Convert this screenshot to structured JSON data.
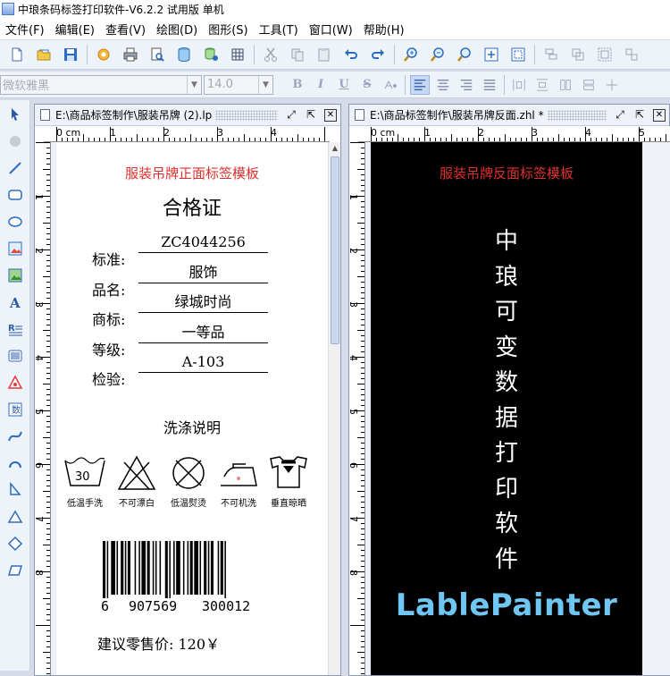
{
  "window": {
    "title": "中琅条码标签打印软件-V6.2.2 试用版 单机"
  },
  "menu": [
    "文件(F)",
    "编辑(E)",
    "查看(V)",
    "绘图(D)",
    "图形(S)",
    "工具(T)",
    "窗口(W)",
    "帮助(H)"
  ],
  "toolbar": {
    "icons": [
      "new-icon",
      "open-icon",
      "save-icon",
      "settings-icon",
      "print-icon",
      "print-preview-icon",
      "database-icon",
      "database-link-icon",
      "grid-icon",
      "cut-icon",
      "copy-icon",
      "paste-icon",
      "undo-icon",
      "redo-icon",
      "zoom-in-icon",
      "zoom-out-icon",
      "zoom-fit-icon",
      "zoom-page-icon",
      "select-all-icon"
    ],
    "font_name": "微软雅黑",
    "font_size": "14.0",
    "bold": "B",
    "italic": "I",
    "underline": "U",
    "strike": "S"
  },
  "left_tools": [
    "pointer-icon",
    "pan-icon",
    "line-icon",
    "rounded-rect-icon",
    "ellipse-icon",
    "image-icon",
    "picture-icon",
    "text-icon",
    "rich-text-icon",
    "barcode-icon",
    "qrcode-icon",
    "serial-icon",
    "curve-icon",
    "arc-icon",
    "polyline-icon",
    "triangle-icon",
    "diamond-icon",
    "parallelogram-icon"
  ],
  "doc_front": {
    "tab_title": "E:\\商品标签制作\\服装吊牌 (2).lp",
    "ruler_top": [
      "0 cm",
      "1",
      "2",
      "3",
      "4"
    ],
    "ruler_left": [
      "1",
      "2",
      "3",
      "4",
      "5",
      "6",
      "7",
      "8"
    ],
    "label_title": "服装吊牌正面标签模板",
    "heading": "合格证",
    "fields": [
      {
        "label": "标准:",
        "value": "ZC4044256"
      },
      {
        "label": "品名:",
        "value": "服饰"
      },
      {
        "label": "商标:",
        "value": "绿城时尚"
      },
      {
        "label": "等级:",
        "value": "一等品"
      },
      {
        "label": "检验:",
        "value": "A-103"
      }
    ],
    "wash_title": "洗涤说明",
    "care": [
      {
        "icon": "wash-30-icon",
        "label": "低温手洗",
        "number": "30"
      },
      {
        "icon": "no-bleach-icon",
        "label": "不可漂白"
      },
      {
        "icon": "low-temp-dry-icon",
        "label": "低温熨烫"
      },
      {
        "icon": "iron-icon",
        "label": "不可机洗"
      },
      {
        "icon": "hang-dry-icon",
        "label": "垂直晾晒"
      }
    ],
    "barcode": {
      "d1": "6",
      "d2": "907569",
      "d3": "300012"
    },
    "price": "建议零售价: 120￥"
  },
  "doc_back": {
    "tab_title": "E:\\商品标签制作\\服装吊牌反面.zhl *",
    "ruler_top": [
      "0 cm",
      "1",
      "2",
      "3",
      "4",
      "5"
    ],
    "ruler_left": [
      "1",
      "2",
      "3",
      "4",
      "5",
      "6",
      "7",
      "8"
    ],
    "label_title": "服装吊牌反面标签模板",
    "vertical_chars": [
      "中",
      "琅",
      "可",
      "变",
      "数",
      "据",
      "打",
      "印",
      "软",
      "件"
    ],
    "brand": "LablePainter"
  }
}
